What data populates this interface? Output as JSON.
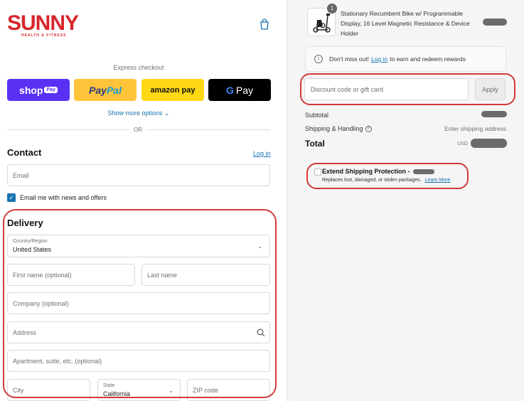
{
  "brand": {
    "name": "SUNNY",
    "tagline": "HEALTH & FITNESS",
    "color": "#d7262c"
  },
  "header": {
    "cart_icon": "shopping-bag-icon"
  },
  "express": {
    "title": "Express checkout",
    "shop_label": "shop",
    "shop_badge": "Pay",
    "paypal_a": "Pay",
    "paypal_b": "Pal",
    "amazon_label": "amazon pay",
    "gpay_g": "G",
    "gpay_label": "Pay",
    "show_more": "Show more options ⌄",
    "or": "OR"
  },
  "contact": {
    "heading": "Contact",
    "login": "Log in",
    "email_placeholder": "Email",
    "newsletter_label": "Email me with news and offers",
    "newsletter_checked": true
  },
  "delivery": {
    "heading": "Delivery",
    "country_label": "Country/Region",
    "country_value": "United States",
    "first_name": "First name (optional)",
    "last_name": "Last name",
    "company": "Company (optional)",
    "address": "Address",
    "apartment": "Apartment, suite, etc. (optional)",
    "city": "City",
    "state_label": "State",
    "state_value": "California",
    "zip": "ZIP code"
  },
  "summary": {
    "quantity": "1",
    "product_title": "Stationary Recumbent Bike w/ Programmable Display, 16 Level Magnetic Resistance & Device Holder",
    "notice_prefix": "Don't miss out!",
    "notice_link": "Log in",
    "notice_suffix": "to earn and redeem rewards",
    "discount_placeholder": "Discount code or gift card",
    "apply": "Apply",
    "subtotal": "Subtotal",
    "shipping": "Shipping & Handling",
    "shipping_value": "Enter shipping address",
    "total": "Total",
    "currency": "USD"
  },
  "extend": {
    "title": "Extend Shipping Protection -",
    "description": "Replaces lost, damaged, or stolen packages.",
    "learn_more": "Learn More"
  },
  "colors": {
    "accent": "#1773b0",
    "highlight": "#d33a3a",
    "shop": "#5a31f4",
    "paypal": "#ffc439",
    "amazon": "#ffd814"
  }
}
